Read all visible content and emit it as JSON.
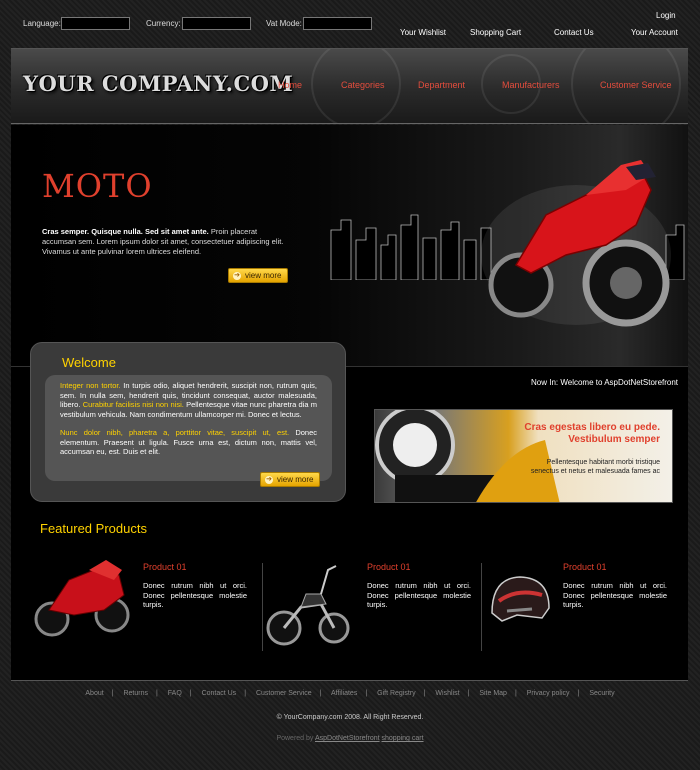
{
  "topbar": {
    "language_label": "Language:",
    "currency_label": "Currency:",
    "vat_label": "Vat Mode:",
    "login": "Login",
    "links": [
      "Your Wishlist",
      "Shopping Cart",
      "Contact Us",
      "Your Account"
    ]
  },
  "header": {
    "logo": "YOUR COMPANY.COM",
    "nav": [
      "Home",
      "Categories",
      "Department",
      "Manufacturers",
      "Customer Service"
    ]
  },
  "hero": {
    "title": "MOTO",
    "text_bold": "Cras semper. Quisque nulla. Sed sit amet ante.",
    "text": " Proin placerat accumsan sem. Lorem ipsum dolor sit amet, consectetuer adipiscing elit. Vivamus ut ante pulvinar lorem ultrices eleifend.",
    "button": "view more"
  },
  "welcome": {
    "title": "Welcome",
    "p1_yellow": "Integer non tortor.",
    "p1_a": " In turpis odio, aliquet hendrerit, suscipit non, rutrum quis, sem. In nulla sem, hendrerit quis, tincidunt consequat, auctor malesuada, libero. ",
    "p1_yellow2": "Curabitur facilisis nisi non nisi.",
    "p1_b": " Pellentesque vitae nunc pharetra dia m vestibulum vehicula. Nam condimentum ullamcorper mi. Donec et lectus.",
    "p2_yellow": "Nunc dolor nibh, pharetra a, porttitor vitae, suscipit ut, est.",
    "p2": " Donec elementum. Praesent ut ligula. Fusce urna est, dictum non, mattis vel, accumsan eu, est. Duis et elit.",
    "button": "view more"
  },
  "now_in": "Now In: Welcome to AspDotNetStorefront",
  "banner": {
    "headline1": "Cras egestas libero eu pede.",
    "headline2": "Vestibulum semper",
    "text1": "Pellentesque habitant morbi tristique",
    "text2": "senectus et netus et malesuada fames ac"
  },
  "featured": {
    "title": "Featured Products",
    "products": [
      {
        "name": "Product 01",
        "desc": "Donec rutrum nibh ut orci. Donec pellentesque molestie turpis."
      },
      {
        "name": "Product 01",
        "desc": "Donec rutrum nibh ut orci. Donec pellentesque molestie turpis."
      },
      {
        "name": "Product 01",
        "desc": "Donec rutrum nibh ut orci. Donec pellentesque molestie turpis."
      }
    ]
  },
  "footer": {
    "links": [
      "About",
      "Returns",
      "FAQ",
      "Contact Us",
      "Customer Service",
      "Affiliates",
      "Gift Registry",
      "Wishlist",
      "Site Map",
      "Privacy policy",
      "Security"
    ],
    "copyright": "© YourCompany.com 2008. All Right Reserved.",
    "powered_prefix": "Powered by",
    "powered_link1": "AspDotNetStorefront",
    "powered_link2": "shopping cart"
  }
}
